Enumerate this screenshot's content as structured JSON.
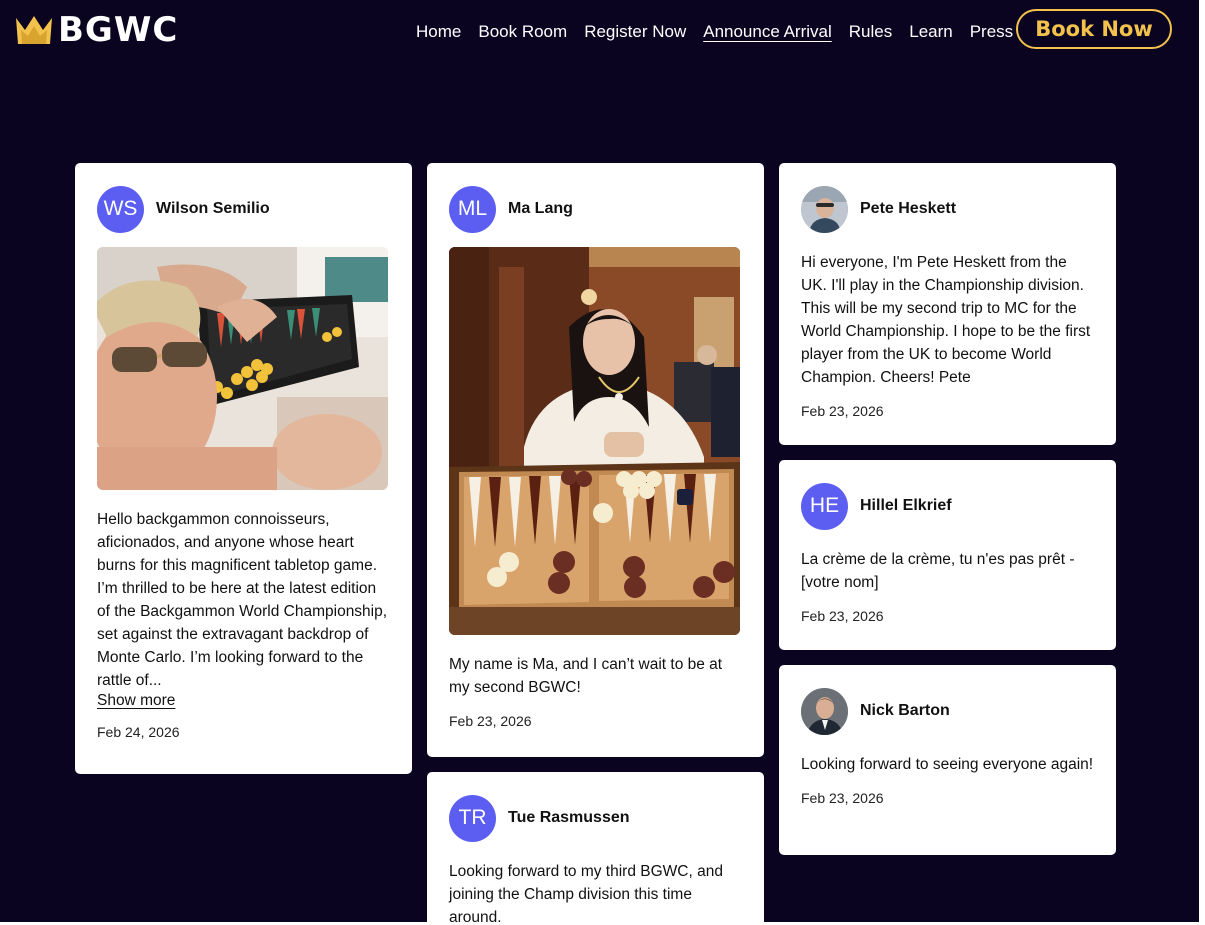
{
  "brand": {
    "name": "BGWC",
    "accent": "#f2c24d"
  },
  "nav": {
    "items": [
      "Home",
      "Book Room",
      "Register Now",
      "Announce Arrival",
      "Rules",
      "Learn",
      "Press"
    ],
    "active": "Announce Arrival",
    "cta": "Book Now"
  },
  "posts": {
    "wilson": {
      "initials": "WS",
      "author": "Wilson Semilio",
      "text": "Hello backgammon connoisseurs, aficionados, and anyone whose heart burns for this magnificent tabletop game. I’m thrilled to be here at the latest edition of the Backgammon World Championship, set against the extravagant backdrop of Monte Carlo. I’m looking forward to the rattle of...",
      "more": "Show more",
      "date": "Feb 24, 2026"
    },
    "ma": {
      "initials": "ML",
      "author": "Ma Lang",
      "text": "My name is Ma, and I can’t wait to be at my second BGWC!",
      "date": "Feb 23, 2026"
    },
    "tue": {
      "initials": "TR",
      "author": "Tue Rasmussen",
      "text": "Looking forward to my third BGWC, and joining the Champ division this time around."
    },
    "pete": {
      "author": "Pete Heskett",
      "text": "Hi everyone, I'm Pete Heskett from the UK. I'll play in the Championship division. This will be my second trip to MC for the World Championship. I hope to be the first player from the UK to become World Champion. Cheers! Pete",
      "date": "Feb 23, 2026"
    },
    "hillel": {
      "initials": "HE",
      "author": "Hillel Elkrief",
      "text": "La crème de la crème, tu n'es pas prêt - [votre nom]",
      "date": "Feb 23, 2026"
    },
    "nick": {
      "author": "Nick Barton",
      "text": "Looking forward to seeing everyone again!",
      "date": "Feb 23, 2026"
    }
  }
}
